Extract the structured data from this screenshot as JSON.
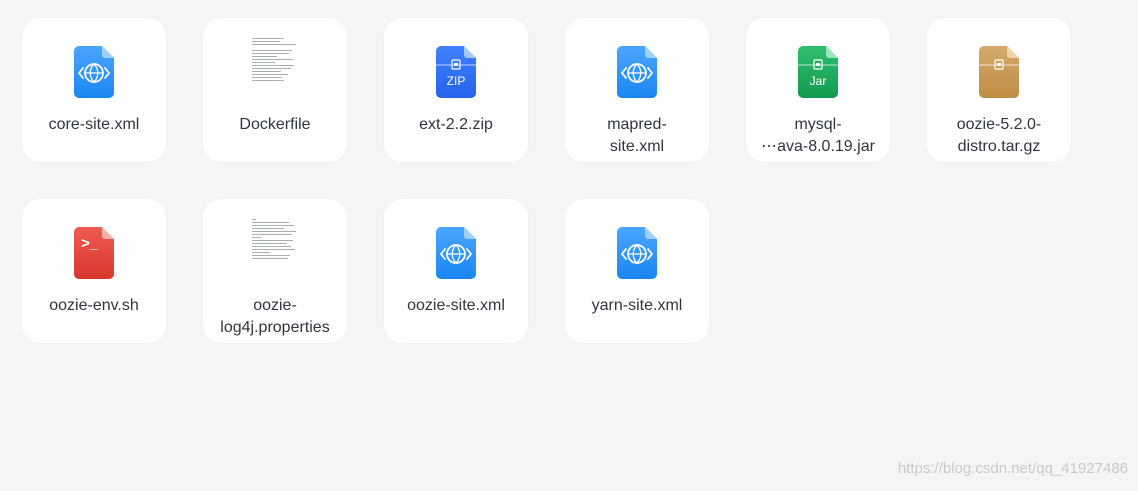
{
  "files": [
    {
      "name": "core-site.xml",
      "icon": "xml-file-icon",
      "color": "#1e8ef7"
    },
    {
      "name": "Dockerfile",
      "icon": "text-thumbnail",
      "color": "#9aa0a6"
    },
    {
      "name": "ext-2.2.zip",
      "icon": "zip-file-icon",
      "color": "#2f6ef2",
      "badge": "ZIP"
    },
    {
      "name": "mapred-\nsite.xml",
      "icon": "xml-file-icon",
      "color": "#1e8ef7"
    },
    {
      "name": "mysql-\n⋯ava-8.0.19.jar",
      "icon": "jar-file-icon",
      "color": "#17a35a",
      "badge": "Jar"
    },
    {
      "name": "oozie-5.2.0-\ndistro.tar.gz",
      "icon": "archive-file-icon",
      "color": "#c89a55"
    },
    {
      "name": "oozie-env.sh",
      "icon": "shell-script-icon",
      "color": "#e0443e",
      "badge": ">_"
    },
    {
      "name": "oozie-\nlog4j.properties",
      "icon": "text-thumbnail",
      "color": "#9aa0a6"
    },
    {
      "name": "oozie-site.xml",
      "icon": "xml-file-icon",
      "color": "#1e8ef7"
    },
    {
      "name": "yarn-site.xml",
      "icon": "xml-file-icon",
      "color": "#1e8ef7"
    }
  ],
  "watermark": "https://blog.csdn.net/qq_41927486"
}
